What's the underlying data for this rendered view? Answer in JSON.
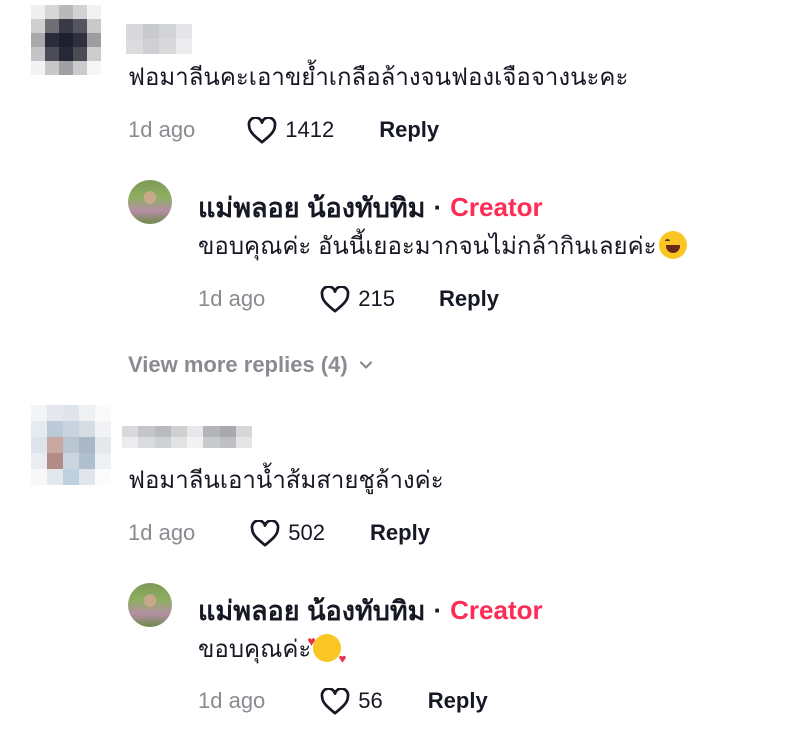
{
  "comments": [
    {
      "text": "ฟอมาลีนคะเอาขย้ำเกลือล้างจนฟองเจือจางนะคะ",
      "time": "1d ago",
      "likes": "1412",
      "reply_label": "Reply",
      "creator_reply": {
        "name": "แม่พลอย น้องทับทิม",
        "separator": "·",
        "tag": "Creator",
        "text": "ขอบคุณค่ะ อันนี้เยอะมากจนไม่กล้ากินเลยค่ะ",
        "emoji": "face-with-tears-of-joy-icon",
        "time": "1d ago",
        "likes": "215",
        "reply_label": "Reply"
      },
      "view_more": "View more replies (4)"
    },
    {
      "text": "ฟอมาลีนเอาน้ำส้มสายชูล้างค่ะ",
      "time": "1d ago",
      "likes": "502",
      "reply_label": "Reply",
      "creator_reply": {
        "name": "แม่พลอย น้องทับทิม",
        "separator": "·",
        "tag": "Creator",
        "text": "ขอบคุณค่ะ",
        "emoji": "smiling-face-with-hearts-icon",
        "time": "1d ago",
        "likes": "56",
        "reply_label": "Reply"
      }
    }
  ],
  "colors": {
    "creator_tag": "#fe2c55",
    "secondary_text": "#8a8b91",
    "primary_text": "#161823"
  }
}
